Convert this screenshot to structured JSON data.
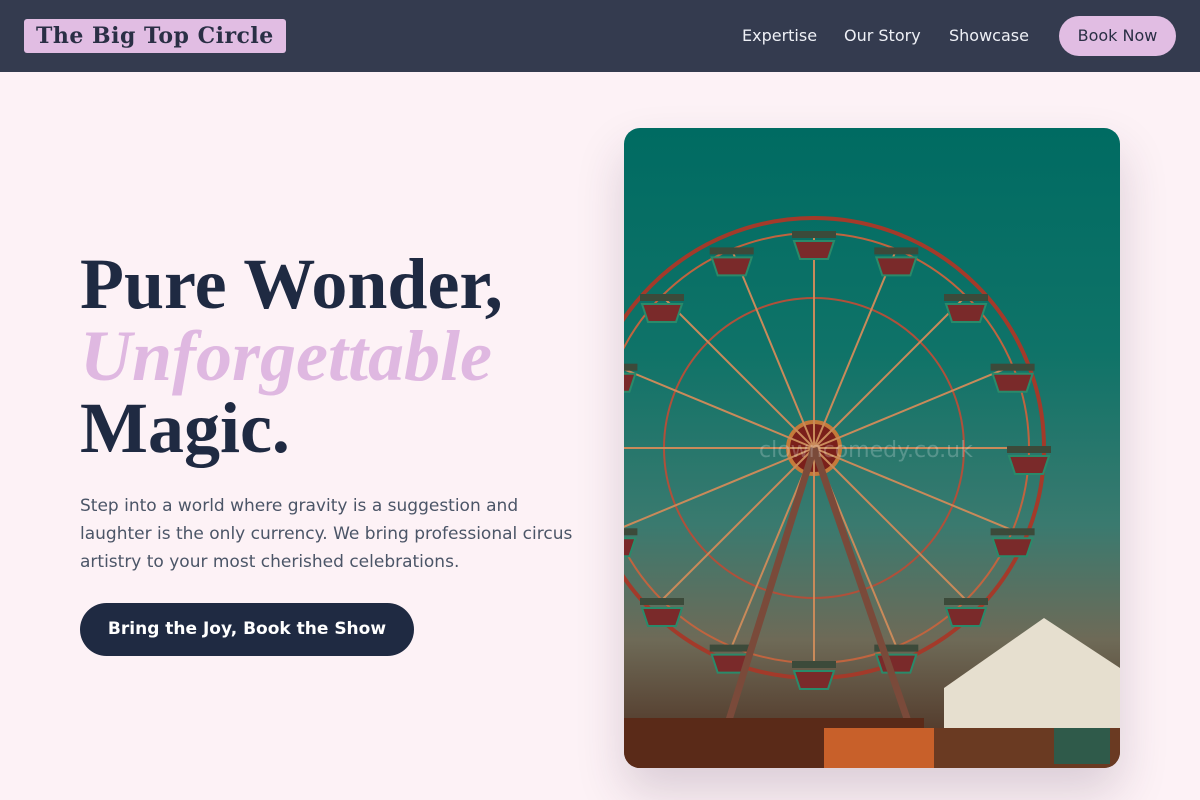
{
  "nav": {
    "logo": "The Big Top Circle",
    "links": [
      "Expertise",
      "Our Story",
      "Showcase"
    ],
    "book_label": "Book Now"
  },
  "hero": {
    "headline_line1": "Pure Wonder,",
    "headline_accent": "Unforgettable",
    "headline_line3": "Magic.",
    "intro": "Step into a world where gravity is a suggestion and laughter is the only currency. We bring professional circus artistry to your most cherished celebrations.",
    "cta_label": "Bring the Joy, Book the Show",
    "image": {
      "subject": "ferris wheel at a carnival",
      "watermark": "clowncomedy.co.uk"
    }
  },
  "colors": {
    "nav_background": "#343b4f",
    "accent_lilac": "#e1bde3",
    "page_background": "#fdf2f6",
    "heading_navy": "#1f2a42"
  }
}
